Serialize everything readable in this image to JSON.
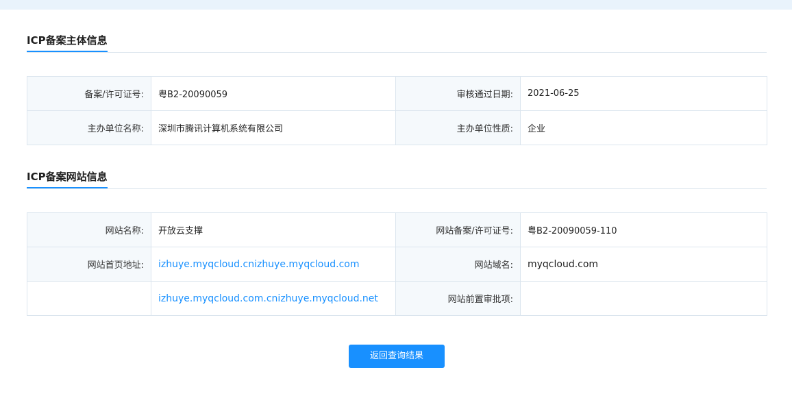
{
  "subject_section": {
    "title": "ICP备案主体信息",
    "rows": [
      {
        "label1": "备案/许可证号:",
        "value1": "粤B2-20090059",
        "label2": "审核通过日期:",
        "value2": "2021-06-25"
      },
      {
        "label1": "主办单位名称:",
        "value1": "深圳市腾讯计算机系统有限公司",
        "label2": "主办单位性质:",
        "value2": "企业"
      }
    ]
  },
  "website_section": {
    "title": "ICP备案网站信息",
    "site_name_label": "网站名称:",
    "site_name": "开放云支撑",
    "site_license_label": "网站备案/许可证号:",
    "site_license": "粤B2-20090059-110",
    "homepage_label": "网站首页地址:",
    "homepage_urls": [
      "izhuye.myqcloud.cnizhuye.myqcloud.com",
      "izhuye.myqcloud.com.cnizhuye.myqcloud.net"
    ],
    "domain_label": "网站域名:",
    "domain": "myqcloud.com",
    "pre_approval_label": "网站前置审批项:",
    "pre_approval": ""
  },
  "back_button_label": "返回查询结果",
  "colors": {
    "accent": "#1890ff",
    "label_bg": "#f5f9fc",
    "border": "#dbe5ee"
  }
}
